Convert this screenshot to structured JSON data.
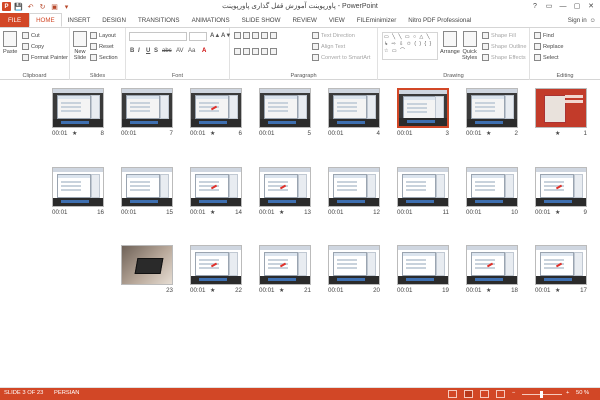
{
  "window": {
    "title": "پاورپوینت آموزش قفل گذاری پاورپوینت - PowerPoint",
    "app_logo": "P",
    "controls": [
      "?",
      "▭",
      "—",
      "▢",
      "✕"
    ]
  },
  "qat": {
    "save_icon": "💾",
    "undo_icon": "↶",
    "redo_icon": "↻",
    "start_icon": "▣",
    "more_icon": "▾"
  },
  "tabs": [
    {
      "label": "FILE",
      "kind": "file"
    },
    {
      "label": "HOME",
      "kind": "active"
    },
    {
      "label": "INSERT"
    },
    {
      "label": "DESIGN"
    },
    {
      "label": "TRANSITIONS"
    },
    {
      "label": "ANIMATIONS"
    },
    {
      "label": "SLIDE SHOW"
    },
    {
      "label": "REVIEW"
    },
    {
      "label": "VIEW"
    },
    {
      "label": "FILEminimizer"
    },
    {
      "label": "Nitro PDF Professional"
    }
  ],
  "user": {
    "signin": "Sign in",
    "avatar_icon": "☺"
  },
  "ribbon": {
    "clipboard": {
      "label": "Clipboard",
      "paste": "Paste",
      "cut": "Cut",
      "copy": "Copy",
      "format_painter": "Format Painter"
    },
    "slides": {
      "label": "Slides",
      "new_slide": "New",
      "new_slide2": "Slide",
      "layout": "Layout",
      "reset": "Reset",
      "section": "Section"
    },
    "font": {
      "label": "Font",
      "bold": "B",
      "italic": "I",
      "underline": "U",
      "shadow": "S",
      "strike": "abc",
      "spacing": "AV",
      "case": "Aa",
      "color": "A",
      "grow": "A▲",
      "shrink": "A▼"
    },
    "paragraph": {
      "label": "Paragraph",
      "text_direction": "Text Direction",
      "align_text": "Align Text",
      "convert_smartart": "Convert to SmartArt"
    },
    "drawing": {
      "label": "Drawing",
      "arrange": "Arrange",
      "quick_styles": "Quick",
      "quick_styles2": "Styles",
      "shape_fill": "Shape Fill",
      "shape_outline": "Shape Outline",
      "shape_effects": "Shape Effects",
      "shapes_gallery": "▭ ╲ ╲ ▭ ○ △ ╲ ↳ ⇨ ⇩ ✩ ( ) { } ☆ ▭ ⌒"
    },
    "editing": {
      "label": "Editing",
      "find": "Find",
      "replace": "Replace",
      "select": "Select"
    }
  },
  "slides": [
    {
      "num": "1",
      "time": "",
      "star": "★",
      "kind": "cover",
      "row": 0,
      "col": 0
    },
    {
      "num": "2",
      "time": "00:01",
      "star": "★",
      "kind": "dark",
      "row": 0,
      "col": 1
    },
    {
      "num": "3",
      "time": "00:01",
      "star": "",
      "kind": "dark",
      "row": 0,
      "col": 2,
      "selected": true
    },
    {
      "num": "4",
      "time": "00:01",
      "star": "",
      "kind": "dark",
      "row": 0,
      "col": 3
    },
    {
      "num": "5",
      "time": "00:01",
      "star": "",
      "kind": "dark",
      "row": 0,
      "col": 4
    },
    {
      "num": "6",
      "time": "00:01",
      "star": "★",
      "kind": "dark",
      "mark": true,
      "row": 0,
      "col": 5
    },
    {
      "num": "7",
      "time": "00:01",
      "star": "",
      "kind": "dark",
      "row": 0,
      "col": 6
    },
    {
      "num": "8",
      "time": "00:01",
      "star": "★",
      "kind": "dark",
      "row": 0,
      "col": 7
    },
    {
      "num": "9",
      "time": "00:01",
      "star": "★",
      "kind": "screen",
      "mark": true,
      "row": 1,
      "col": 0
    },
    {
      "num": "10",
      "time": "00:01",
      "star": "",
      "kind": "screen",
      "row": 1,
      "col": 1
    },
    {
      "num": "11",
      "time": "00:01",
      "star": "",
      "kind": "screen",
      "row": 1,
      "col": 2
    },
    {
      "num": "12",
      "time": "00:01",
      "star": "",
      "kind": "screen",
      "row": 1,
      "col": 3
    },
    {
      "num": "13",
      "time": "00:01",
      "star": "★",
      "kind": "screen",
      "mark": true,
      "row": 1,
      "col": 4
    },
    {
      "num": "14",
      "time": "00:01",
      "star": "★",
      "kind": "screen",
      "mark": true,
      "row": 1,
      "col": 5
    },
    {
      "num": "15",
      "time": "00:01",
      "star": "",
      "kind": "screen",
      "row": 1,
      "col": 6
    },
    {
      "num": "16",
      "time": "00:01",
      "star": "",
      "kind": "screen",
      "row": 1,
      "col": 7
    },
    {
      "num": "17",
      "time": "00:01",
      "star": "★",
      "kind": "screen",
      "mark": true,
      "row": 2,
      "col": 0
    },
    {
      "num": "18",
      "time": "00:01",
      "star": "★",
      "kind": "screen",
      "mark": true,
      "row": 2,
      "col": 1
    },
    {
      "num": "19",
      "time": "00:01",
      "star": "",
      "kind": "screen",
      "row": 2,
      "col": 2
    },
    {
      "num": "20",
      "time": "00:01",
      "star": "",
      "kind": "screen",
      "row": 2,
      "col": 3
    },
    {
      "num": "21",
      "time": "00:01",
      "star": "★",
      "kind": "screen",
      "mark": true,
      "row": 2,
      "col": 4
    },
    {
      "num": "22",
      "time": "00:01",
      "star": "★",
      "kind": "screen",
      "mark": true,
      "row": 2,
      "col": 5
    },
    {
      "num": "23",
      "time": "",
      "star": "",
      "kind": "photo",
      "row": 2,
      "col": 6
    }
  ],
  "status": {
    "slide_info": "SLIDE 3 OF 23",
    "language": "PERSIAN",
    "zoom": "50 %",
    "zoom_minus": "−",
    "zoom_plus": "+"
  }
}
